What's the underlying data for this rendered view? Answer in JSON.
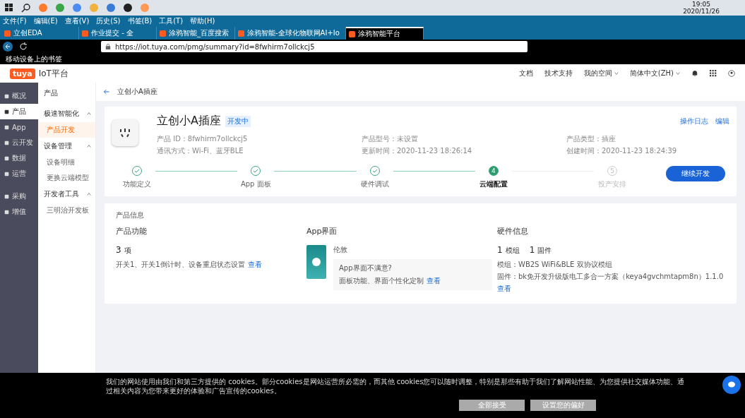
{
  "taskbar": {
    "time": "19:05",
    "date": "2020/11/26"
  },
  "browser": {
    "menu": [
      "文件(F)",
      "编辑(E)",
      "查看(V)",
      "历史(S)",
      "书签(B)",
      "工具(T)",
      "帮助(H)"
    ],
    "tabs": [
      {
        "label": "立创EDA",
        "selected": false
      },
      {
        "label": "作业提交 - 全",
        "selected": false
      },
      {
        "label": "涂鸦智能_百度搜索",
        "selected": false
      },
      {
        "label": "涂鸦智能-全球化物联网AI+Io",
        "selected": false
      },
      {
        "label": "涂鸦智能平台",
        "selected": true
      }
    ],
    "url": "https://iot.tuya.com/pmg/summary?id=8fwhirm7ollckcj5",
    "bookmark": "移动设备上的书签"
  },
  "header": {
    "logo": "tuya",
    "title": "IoT平台",
    "links": [
      {
        "label": "文档",
        "dropdown": false
      },
      {
        "label": "技术支持",
        "dropdown": false
      },
      {
        "label": "我的空间",
        "dropdown": true
      },
      {
        "label": "简体中文(ZH)",
        "dropdown": true
      }
    ]
  },
  "sidebar": {
    "items": [
      {
        "label": "概况",
        "selected": false
      },
      {
        "label": "产品",
        "selected": true
      },
      {
        "label": "App",
        "selected": false
      },
      {
        "label": "云开发",
        "selected": false
      },
      {
        "label": "数据",
        "selected": false
      },
      {
        "label": "运营",
        "selected": false
      },
      {
        "label": "采购",
        "selected": false
      },
      {
        "label": "增值",
        "selected": false
      }
    ]
  },
  "subnav": {
    "title": "产品",
    "groups": [
      {
        "label": "极速智能化",
        "expanded": true,
        "children": [
          {
            "label": "产品开发",
            "selected": true
          }
        ]
      },
      {
        "label": "设备管理",
        "expanded": true,
        "children": [
          {
            "label": "设备明细",
            "selected": false
          },
          {
            "label": "更换云端模型",
            "selected": false
          }
        ]
      },
      {
        "label": "开发者工具",
        "expanded": true,
        "children": [
          {
            "label": "三明治开发板",
            "selected": false
          }
        ]
      }
    ]
  },
  "page": {
    "title": "立创小A插座",
    "product": {
      "name": "立创小A插座",
      "badge": "开发中",
      "actions": [
        "操作日志",
        "编辑"
      ],
      "meta": [
        [
          {
            "label": "产品 ID：",
            "value": "8fwhirm7ollckcj5"
          },
          {
            "label": "通讯方式：",
            "value": "Wi-Fi、蓝牙BLE"
          }
        ],
        [
          {
            "label": "产品型号：",
            "value": "未设置"
          },
          {
            "label": "更新时间：",
            "value": "2020-11-23 18:26:14"
          }
        ],
        [
          {
            "label": "产品类型：",
            "value": "插座"
          },
          {
            "label": "创建时间：",
            "value": "2020-11-23 18:24:39"
          }
        ]
      ]
    },
    "steps": [
      {
        "label": "功能定义",
        "done": true,
        "selected": false
      },
      {
        "label": "App 面板",
        "done": true,
        "selected": false
      },
      {
        "label": "硬件调试",
        "done": true,
        "selected": false
      },
      {
        "label": "云端配置",
        "number": "4",
        "done": false,
        "selected": true
      },
      {
        "label": "投产安排",
        "number": "5",
        "done": false,
        "selected": false
      }
    ],
    "continue_button": "继续开发",
    "info": {
      "title": "产品信息",
      "functions": {
        "heading": "产品功能",
        "count": "3",
        "unit": "项",
        "text": "开关1、开关1倒计时、设备重启状态设置",
        "link": "查看"
      },
      "app": {
        "heading": "App界面",
        "panel": "伦敦",
        "question": "App界面不满意?",
        "text": "面板功能、界面个性化定制",
        "link": "查看"
      },
      "hardware": {
        "heading": "硬件信息",
        "counts": [
          {
            "count": "1",
            "unit": "模组"
          },
          {
            "count": "1",
            "unit": "固件"
          }
        ],
        "lines": [
          "模组：WB2S WiFi&BLE 双协议模组",
          "固件：bk免开发升级版电工多合一方案（keya4gvchmtapm8n）1.1.0"
        ],
        "link": "查看"
      }
    }
  },
  "cookie": {
    "text": "我们的网站使用由我们和第三方提供的 cookies。部分cookies是网站运营所必需的，而其他 cookies您可以随时调整，特别是那些有助于我们了解网站性能、为您提供社交媒体功能、通过相关内容为您带来更好的体验和广告宣传的cookies。",
    "buttons": [
      "全部接受",
      "设置您的偏好"
    ]
  }
}
